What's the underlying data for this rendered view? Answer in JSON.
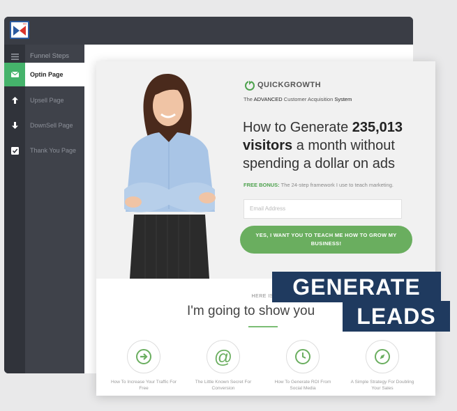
{
  "sidebar": {
    "header": "Funnel Steps",
    "items": [
      {
        "label": "Optin Page",
        "icon": "envelope-icon",
        "active": true
      },
      {
        "label": "Upsell Page",
        "icon": "arrow-up-icon",
        "active": false
      },
      {
        "label": "DownSell Page",
        "icon": "arrow-down-icon",
        "active": false
      },
      {
        "label": "Thank You Page",
        "icon": "checkbox-icon",
        "active": false
      }
    ]
  },
  "landing": {
    "brand": "QUICKGROWTH",
    "tagline_pre": "The ",
    "tagline_b1": "ADVANCED",
    "tagline_mid": " Customer Acquisition ",
    "tagline_b2": "System",
    "headline_1": "How to Generate ",
    "headline_num": "235,013",
    "headline_bold2": "visitors",
    "headline_2": " a month without spending a dollar on ads",
    "bonus_label": "FREE BONUS:",
    "bonus_text": " The 24-step framework I use to teach marketing.",
    "email_placeholder": "Email Address",
    "cta": "YES, I WANT YOU TO TEACH ME HOW TO GROW MY BUSINESS!",
    "here_is": "HERE IS W",
    "show_you": "I'm going to show you",
    "features": [
      {
        "icon": "arrow-right-circle-icon",
        "text": "How To Increase Your Traffic For Free"
      },
      {
        "icon": "at-sign-icon",
        "text": "The Little Known Secret For Conversion"
      },
      {
        "icon": "clock-icon",
        "text": "How To Generate ROI From Social Media"
      },
      {
        "icon": "compass-icon",
        "text": "A Simple Strategy For Doubling Your Sales"
      }
    ]
  },
  "overlay": {
    "line1": "GENERATE",
    "line2": "LEADS"
  },
  "colors": {
    "accent_green": "#45b36b",
    "cta_green": "#6aae5f",
    "sidebar_dark": "#3c3f47",
    "overlay_navy": "#1f3a5f"
  }
}
